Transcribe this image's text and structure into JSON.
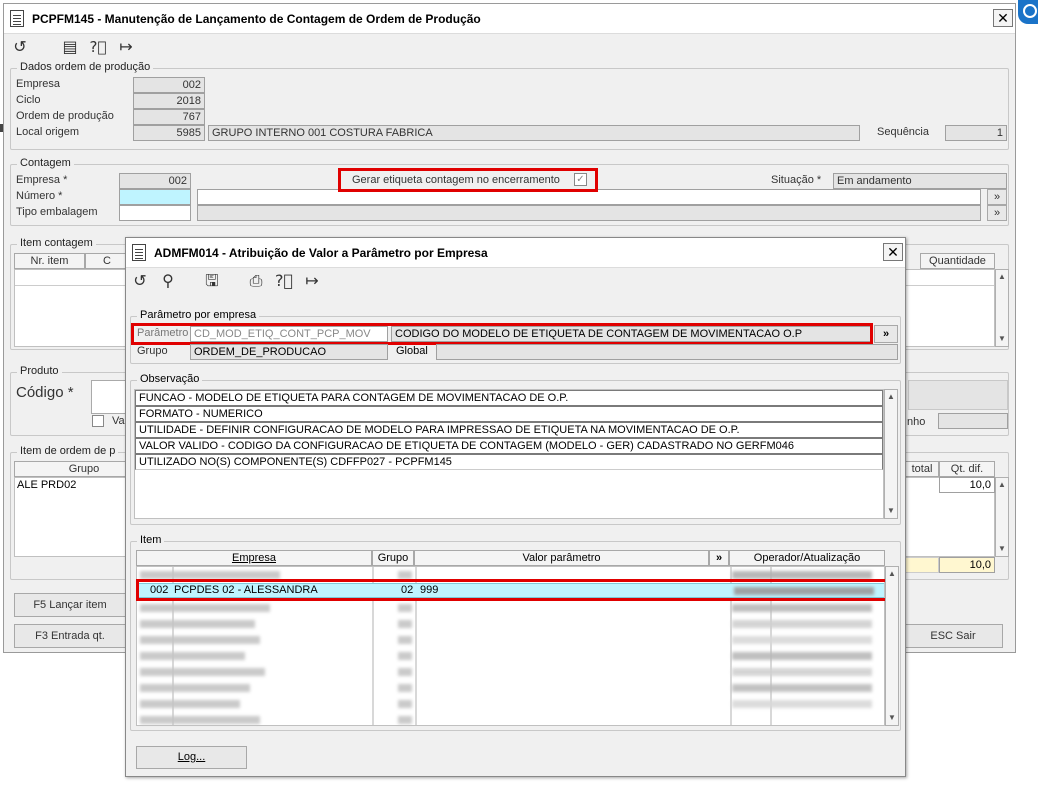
{
  "main_window": {
    "title": "PCPFM145 - Manutenção de Lançamento de Contagem de Ordem de Produção",
    "close_label": "✕",
    "dados": {
      "legend": "Dados ordem de produção",
      "empresa_label": "Empresa",
      "empresa_value": "002",
      "ciclo_label": "Ciclo",
      "ciclo_value": "2018",
      "ordem_label": "Ordem de produção",
      "ordem_value": "767",
      "local_label": "Local origem",
      "local_code": "5985",
      "local_name": "GRUPO INTERNO 001 COSTURA FABRICA",
      "sequencia_label": "Sequência",
      "sequencia_value": "1"
    },
    "contagem": {
      "legend": "Contagem",
      "empresa_label": "Empresa *",
      "empresa_value": "002",
      "numero_label": "Número *",
      "numero_value": "",
      "tipo_label": "Tipo embalagem",
      "tipo_value": "",
      "gerar_label": "Gerar etiqueta contagem no encerramento",
      "gerar_checked": "✓",
      "situacao_label": "Situação *",
      "situacao_value": "Em andamento",
      "lookup_label": "»"
    },
    "item_contagem": {
      "legend": "Item contagem",
      "col_nr": "Nr. item",
      "col_c": "C",
      "col_quantidade": "Quantidade"
    },
    "produto": {
      "legend": "Produto",
      "codigo_label": "Código *",
      "checkbox_label_partial": "Va",
      "right_label_partial": "nho"
    },
    "item_ordem": {
      "legend": "Item de ordem de p",
      "col_grupo": "Grupo",
      "col_total": "total",
      "col_qt": "Qt. dif.",
      "row_grupo": "ALE PRD02",
      "row_qt": "10,0",
      "total_qt": "10,0"
    },
    "buttons": {
      "f5": "F5 Lançar item",
      "f3": "F3 Entrada qt.",
      "esc": "ESC Sair"
    }
  },
  "dialog": {
    "title": "ADMFM014 - Atribuição de Valor a Parâmetro por Empresa",
    "close_label": "✕",
    "parametro_group": {
      "legend": "Parâmetro por empresa",
      "parametro_label": "Parâmetro",
      "parametro_code": "CD_MOD_ETIQ_CONT_PCP_MOV",
      "parametro_desc": "CODIGO DO MODELO DE ETIQUETA DE CONTAGEM DE MOVIMENTACAO O.P",
      "lookup_label": "»",
      "grupo_label": "Grupo",
      "grupo_value": "ORDEM_DE_PRODUCAO",
      "global_label": "Global"
    },
    "observacao": {
      "legend": "Observação",
      "lines": [
        "FUNCAO - MODELO DE ETIQUETA PARA CONTAGEM DE MOVIMENTACAO DE O.P.",
        "FORMATO - NUMERICO",
        "UTILIDADE - DEFINIR CONFIGURACAO DE MODELO PARA IMPRESSAO DE ETIQUETA NA MOVIMENTACAO DE O.P.",
        "VALOR VALIDO - CODIGO DA CONFIGURACAO DE ETIQUETA DE CONTAGEM (MODELO - GER) CADASTRADO NO GERFM046",
        "UTILIZADO NO(S) COMPONENTE(S) CDFFP027 - PCPFM145"
      ]
    },
    "item": {
      "legend": "Item",
      "col_empresa": "Empresa",
      "col_grupo": "Grupo",
      "col_valor": "Valor parâmetro",
      "col_more": "»",
      "col_operador": "Operador/Atualização",
      "selected": {
        "empresa_code": "002",
        "empresa_name": "PCPDES 02 - ALESSANDRA",
        "grupo": "02",
        "valor": "999"
      }
    },
    "log_button": "Log..."
  },
  "colors": {
    "highlight": "#e00000",
    "selected_row": "#bff4ff",
    "window_bg": "#f0f0f0"
  }
}
